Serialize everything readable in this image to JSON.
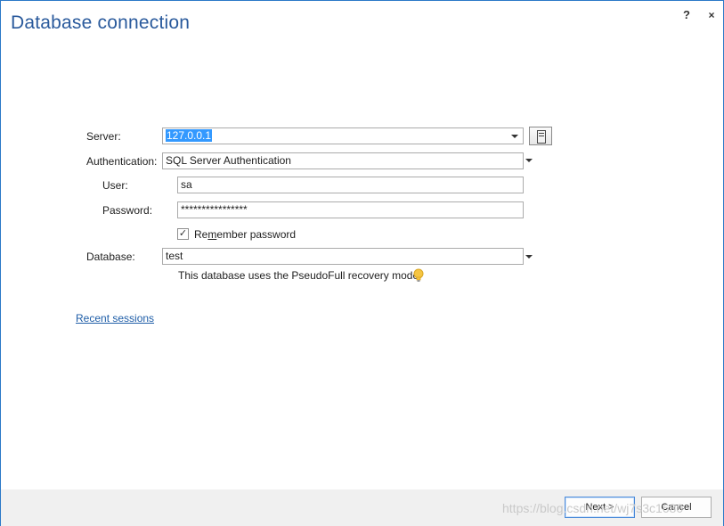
{
  "window": {
    "title": "Database connection",
    "help_label": "?",
    "close_label": "×"
  },
  "form": {
    "server": {
      "label": "Server:",
      "value": "127.0.0.1"
    },
    "authentication": {
      "label": "Authentication:",
      "value": "SQL Server Authentication"
    },
    "user": {
      "label": "User:",
      "value": "sa"
    },
    "password": {
      "label": "Password:",
      "value": "****************"
    },
    "remember": {
      "label_pre": "Re",
      "label_u": "m",
      "label_post": "ember password",
      "checked": true
    },
    "database": {
      "label": "Database:",
      "value": "test",
      "hint": "This database uses the PseudoFull recovery model"
    }
  },
  "links": {
    "recent_sessions": "Recent sessions"
  },
  "footer": {
    "next_label": "Next >",
    "cancel_label": "Cancel",
    "watermark": "https://blog.csdn.net/wj7s3c1680"
  },
  "colors": {
    "title": "#2a5a9c",
    "accent": "#3399ff",
    "link": "#1f5ea8",
    "border": "#2b79c8"
  }
}
